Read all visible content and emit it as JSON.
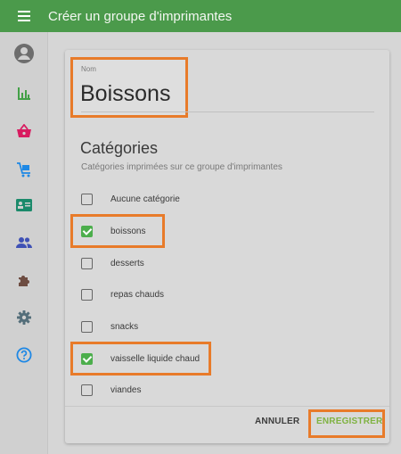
{
  "header": {
    "title": "Créer un groupe d'imprimantes"
  },
  "sidebar": {
    "items": [
      {
        "icon": "user-icon",
        "color": "#6d6d6d"
      },
      {
        "icon": "bar-chart-icon",
        "color": "#43a047"
      },
      {
        "icon": "basket-icon",
        "color": "#d81b60"
      },
      {
        "icon": "cart-icon",
        "color": "#1e88e5"
      },
      {
        "icon": "id-card-icon",
        "color": "#1b8a6b"
      },
      {
        "icon": "people-icon",
        "color": "#3f51b5"
      },
      {
        "icon": "puzzle-icon",
        "color": "#6d4c41"
      },
      {
        "icon": "gear-icon",
        "color": "#546e7a"
      },
      {
        "icon": "help-icon",
        "color": "#1e88e5"
      }
    ]
  },
  "form": {
    "name_label": "Nom",
    "name_value": "Boissons",
    "categories_title": "Catégories",
    "categories_subtitle": "Catégories imprimées sur ce groupe d'imprimantes",
    "categories": [
      {
        "label": "Aucune catégorie",
        "checked": false
      },
      {
        "label": "boissons",
        "checked": true
      },
      {
        "label": "desserts",
        "checked": false
      },
      {
        "label": "repas chauds",
        "checked": false
      },
      {
        "label": "snacks",
        "checked": false
      },
      {
        "label": "vaisselle liquide chaud",
        "checked": true
      },
      {
        "label": "viandes",
        "checked": false
      }
    ]
  },
  "actions": {
    "cancel_label": "ANNULER",
    "save_label": "ENREGISTRER"
  },
  "colors": {
    "app_bar": "#4b9a4b",
    "highlight": "#e87b2a",
    "check": "#4cae4c",
    "save": "#7fb241"
  }
}
